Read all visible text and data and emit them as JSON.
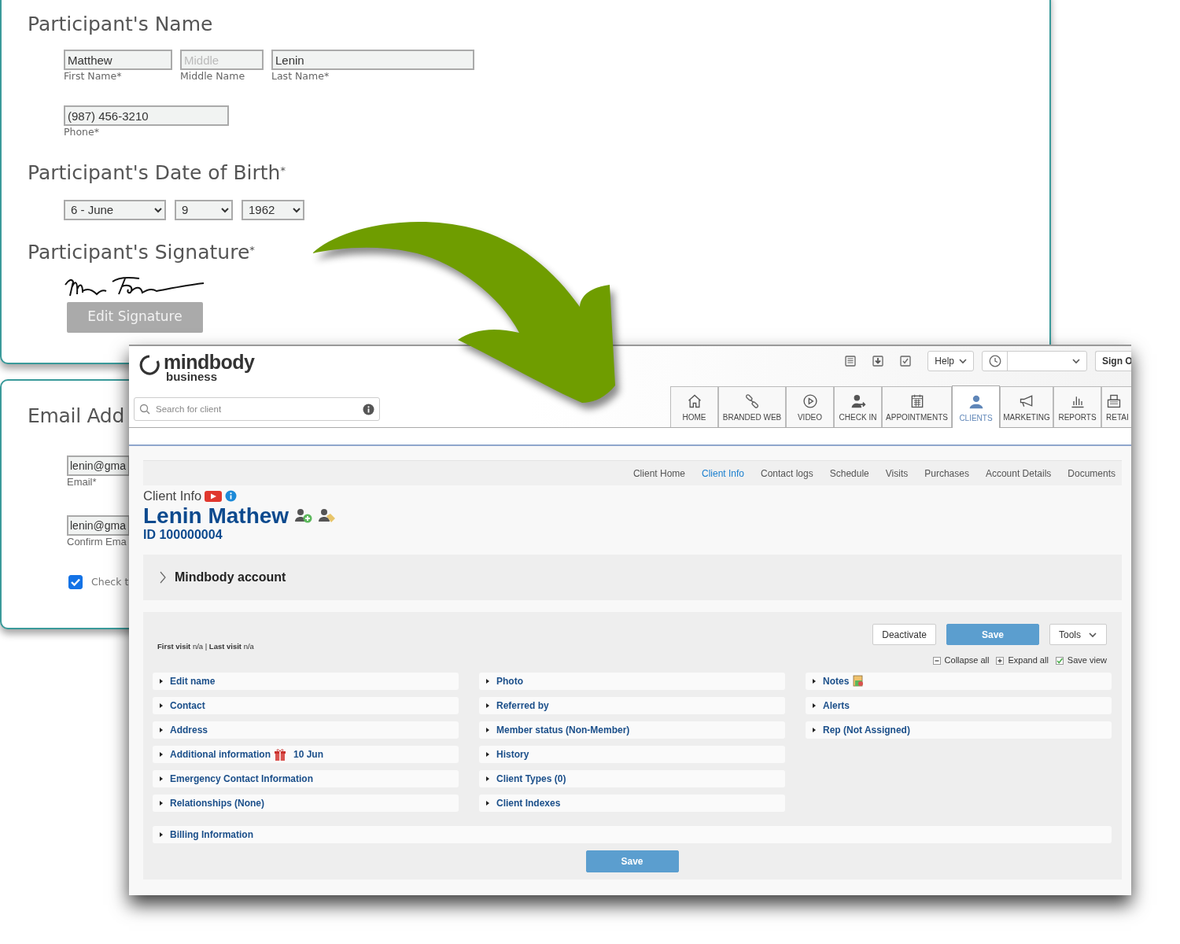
{
  "form_card": {
    "name_title": "Participant's Name",
    "name_fields": [
      {
        "value": "Matthew",
        "label": "First Name*"
      },
      {
        "placeholder": "Middle",
        "label": "Middle Name"
      },
      {
        "value": "Lenin",
        "label": "Last Name*"
      }
    ],
    "phone": {
      "value": "(987) 456-3210",
      "label": "Phone*"
    },
    "dob_title": "Participant's Date of Birth$^{*}$",
    "dob_selects": [
      "6 - June",
      "9",
      "1962"
    ],
    "signature_title": "Participant's Signature$^{*}$",
    "signature_button": "Edit Signature"
  },
  "email_card": {
    "title": "Email Add",
    "fields": [
      {
        "value": "lenin@gma",
        "label": "Email*"
      },
      {
        "value": "lenin@gma",
        "label": "Confirm Ema"
      }
    ],
    "consent": {
      "label": "Check t",
      "checked": true
    }
  },
  "app": {
    "logo": {
      "name": "mindbody",
      "tagline": "business"
    },
    "search": {
      "placeholder": "Search for client"
    },
    "help_button": "Help",
    "sign_out_button": "Sign O",
    "tabs": [
      {
        "label": "HOME",
        "selected": false
      },
      {
        "label": "BRANDED WEB",
        "selected": false
      },
      {
        "label": "VIDEO",
        "selected": false
      },
      {
        "label": "CHECK IN",
        "selected": false
      },
      {
        "label": "APPOINTMENTS",
        "selected": false
      },
      {
        "label": "CLIENTS",
        "selected": true
      },
      {
        "label": "MARKETING",
        "selected": false
      },
      {
        "label": "REPORTS",
        "selected": false
      },
      {
        "label": "RETAI",
        "selected": false
      }
    ],
    "subnav": [
      {
        "label": "Client Home",
        "selected": false
      },
      {
        "label": "Client Info",
        "selected": true
      },
      {
        "label": "Contact logs",
        "selected": false
      },
      {
        "label": "Schedule",
        "selected": false
      },
      {
        "label": "Visits",
        "selected": false
      },
      {
        "label": "Purchases",
        "selected": false
      },
      {
        "label": "Account Details",
        "selected": false
      },
      {
        "label": "Documents",
        "selected": false
      }
    ],
    "client": {
      "section_title": "Client Info",
      "name": "Lenin Mathew",
      "id": "ID 100000004"
    },
    "account_panel": {
      "title": "Mindbody account",
      "expanded": false
    },
    "visits": "**First visit** n/a | **Last visit** n/a",
    "actions": {
      "deactivate": "Deactivate",
      "save": "Save",
      "tools": "Tools"
    },
    "view_controls": {
      "collapse": "Collapse all",
      "expand": "Expand all",
      "save_view": {
        "label": "Save view",
        "checked": true
      }
    },
    "columns": [
      [
        {
          "label": "Edit name",
          "kind": "plain"
        },
        {
          "label": "Contact",
          "kind": "plain"
        },
        {
          "label": "Address",
          "kind": "plain"
        },
        {
          "label": "Additional information",
          "kind": "gift",
          "note": "10 Jun"
        },
        {
          "label": "Emergency Contact Information",
          "kind": "plain"
        },
        {
          "label": "Relationships (None)",
          "kind": "plain"
        }
      ],
      [
        {
          "label": "Photo",
          "kind": "plain"
        },
        {
          "label": "Referred by",
          "kind": "plain"
        },
        {
          "label": "Member status (Non-Member)",
          "kind": "plain"
        },
        {
          "label": "History",
          "kind": "plain"
        },
        {
          "label": "Client Types (0)",
          "kind": "plain"
        },
        {
          "label": "Client Indexes",
          "kind": "plain"
        }
      ],
      [
        {
          "label": "Notes",
          "kind": "notes"
        },
        {
          "label": "Alerts",
          "kind": "plain"
        },
        {
          "label": "Rep (Not Assigned)",
          "kind": "plain"
        }
      ]
    ],
    "billing": "Billing Information",
    "bottom_save": "Save"
  }
}
